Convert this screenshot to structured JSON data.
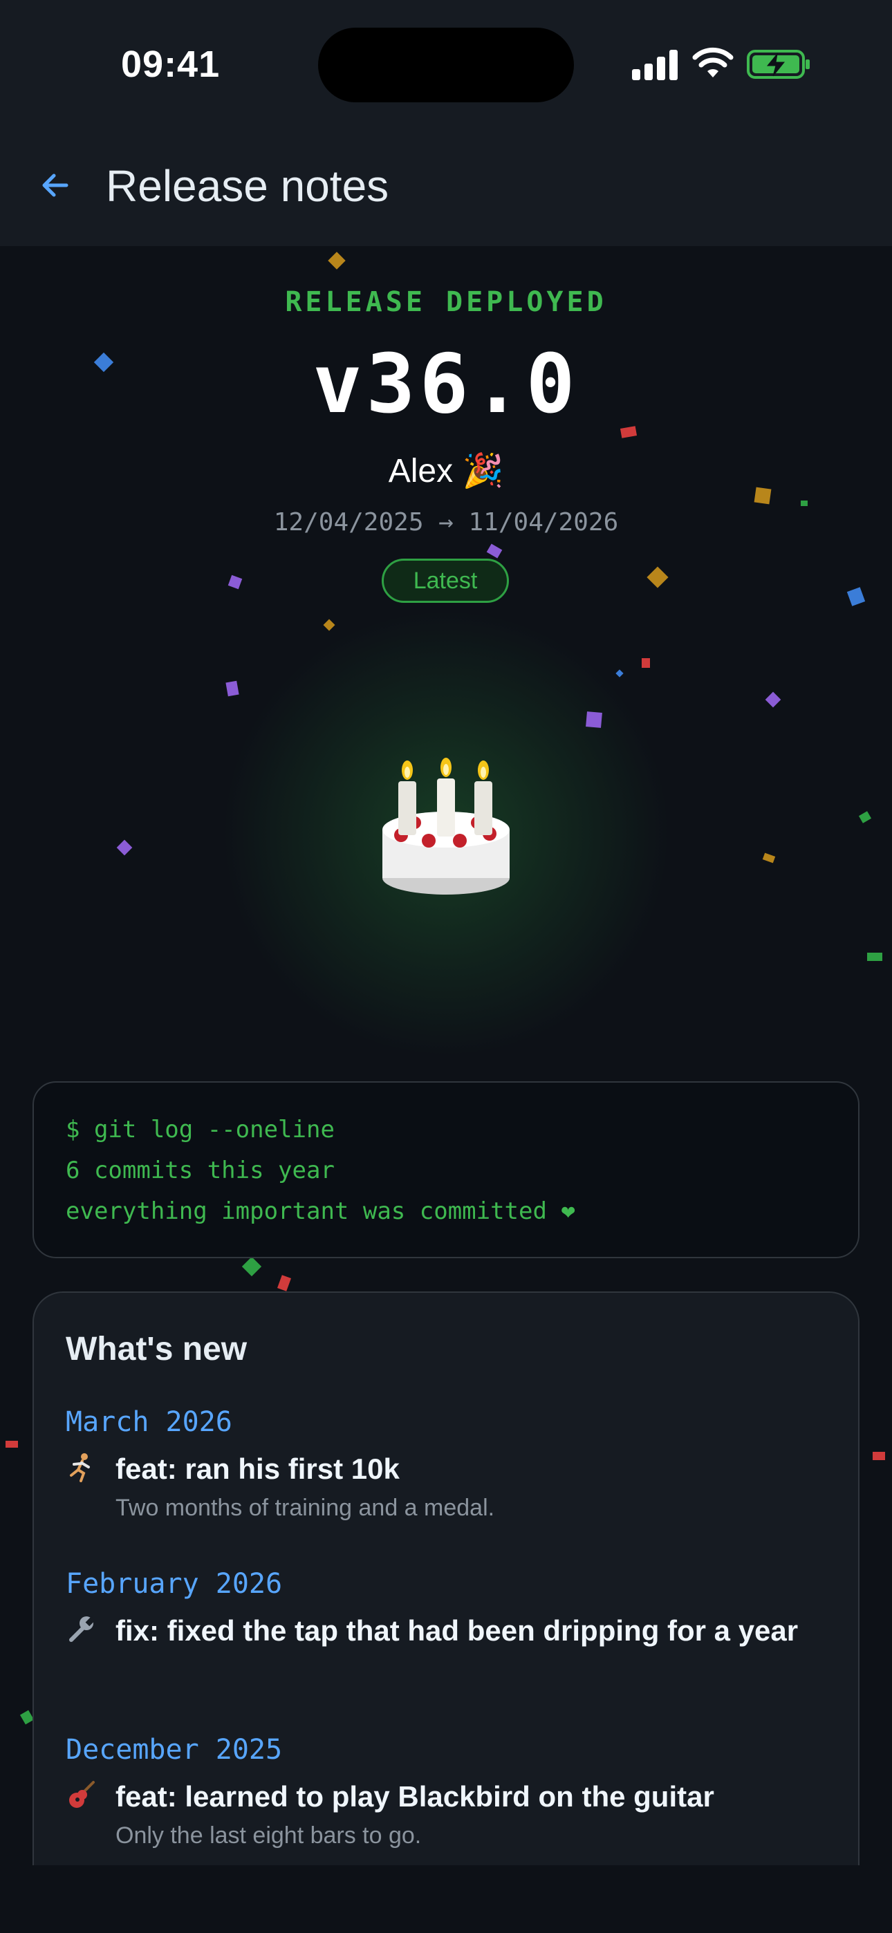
{
  "status_bar": {
    "time": "09:41"
  },
  "nav": {
    "back_icon": "arrow-left-icon",
    "title": "Release notes"
  },
  "hero": {
    "label": "RELEASE DEPLOYED",
    "version": "v36.0",
    "author": "Alex 🎉",
    "date_range": "12/04/2025 → 11/04/2026",
    "badge": "Latest",
    "image_icon": "birthday-cake-icon"
  },
  "terminal": {
    "lines": [
      "$ git log --oneline",
      "6 commits this year",
      "everything important was committed ❤"
    ]
  },
  "whats_new": {
    "title": "What's new",
    "sections": [
      {
        "month": "March 2026",
        "entries": [
          {
            "icon": "runner-icon",
            "title": "feat: ran his first 10k",
            "desc": "Two months of training and a medal."
          }
        ]
      },
      {
        "month": "February 2026",
        "entries": [
          {
            "icon": "wrench-icon",
            "title": "fix: fixed the tap that had been dripping for a year",
            "desc": ""
          }
        ]
      },
      {
        "month": "December 2025",
        "entries": [
          {
            "icon": "guitar-icon",
            "title": "feat: learned to play Blackbird on the guitar",
            "desc": "Only the last eight bars to go."
          }
        ]
      }
    ]
  },
  "colors": {
    "background": "#0d1117",
    "accent_green": "#3fb950",
    "accent_blue": "#58a6ff",
    "card": "#161b22"
  }
}
